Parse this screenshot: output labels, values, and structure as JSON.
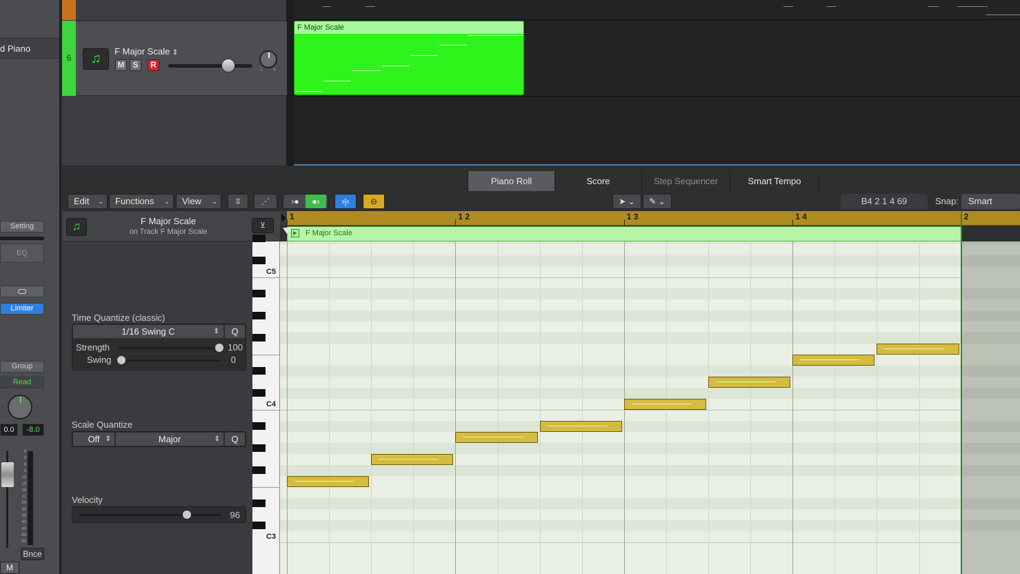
{
  "left_strip": {
    "track_name": "d Piano",
    "setting": "Setting",
    "eq": "EQ",
    "link_icon": "link-icon",
    "insert": "Limiter",
    "group": "Group",
    "automation": "Read",
    "pan_value": "0.0",
    "volume_value": "-8.0",
    "meter_scale": [
      "0",
      "3",
      "6",
      "9",
      "12",
      "15",
      "18",
      "21",
      "24",
      "30",
      "35",
      "40",
      "45",
      "50",
      "60"
    ],
    "bounce": "Bnce",
    "mute": "M"
  },
  "track": {
    "number": "6",
    "name": "F Major Scale",
    "mute": "M",
    "solo": "S",
    "record": "R",
    "pan_label_l": "L",
    "pan_label_r": "R",
    "region_name": "F Major Scale",
    "accent_color": "#2ff41b"
  },
  "editor": {
    "tabs": [
      {
        "label": "Piano Roll",
        "active": true
      },
      {
        "label": "Score",
        "active": false
      },
      {
        "label": "Step Sequencer",
        "active": false
      },
      {
        "label": "Smart Tempo",
        "active": false
      }
    ],
    "menus": {
      "edit": "Edit",
      "functions": "Functions",
      "view": "View"
    },
    "position_display": "B4   2 1 4 69",
    "snap_label": "Snap:",
    "snap_value": "Smart"
  },
  "inspector": {
    "region_name": "F Major Scale",
    "region_sub": "on Track F Major Scale",
    "time_quantize": {
      "title": "Time Quantize (classic)",
      "value": "1/16 Swing C",
      "q": "Q",
      "strength_label": "Strength",
      "strength_value": "100",
      "strength": 1.0,
      "swing_label": "Swing",
      "swing_value": "0",
      "swing": 0.0
    },
    "scale_quantize": {
      "title": "Scale Quantize",
      "root": "Off",
      "scale": "Major",
      "q": "Q"
    },
    "velocity": {
      "title": "Velocity",
      "value": "96",
      "fraction": 0.756
    }
  },
  "piano_roll": {
    "ruler": [
      "1",
      "1 2",
      "1 3",
      "1 4",
      "2"
    ],
    "region_name": "F Major Scale",
    "key_labels": [
      "C5",
      "C4",
      "C3"
    ],
    "notes": [
      {
        "pitch": "F3",
        "beat": 1
      },
      {
        "pitch": "G3",
        "beat": 2
      },
      {
        "pitch": "A3",
        "beat": 3
      },
      {
        "pitch": "Bb3",
        "beat": 4
      },
      {
        "pitch": "C4",
        "beat": 5
      },
      {
        "pitch": "D4",
        "beat": 6
      },
      {
        "pitch": "E4",
        "beat": 7
      },
      {
        "pitch": "F4",
        "beat": 8
      }
    ],
    "note_color": "#d4bc3e"
  }
}
